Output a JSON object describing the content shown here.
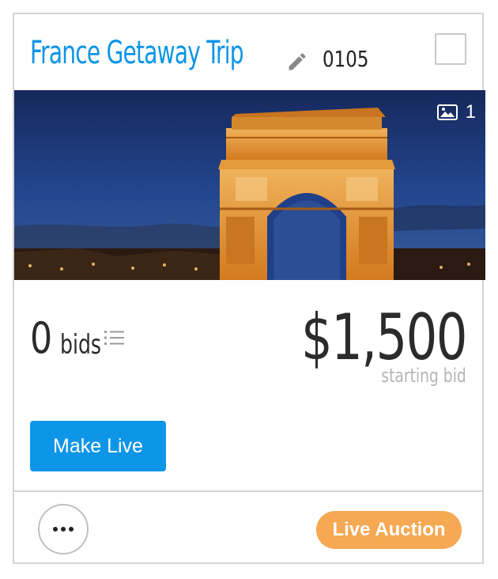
{
  "item": {
    "title": "France Getaway Trip",
    "number": "0105",
    "photo_count": "1",
    "photo_subject": "Arc de Triomphe at dusk"
  },
  "bids": {
    "count": "0",
    "label": "bids"
  },
  "price": {
    "amount": "$1,500",
    "caption": "starting bid"
  },
  "actions": {
    "make_live_label": "Make Live"
  },
  "footer": {
    "status_badge": "Live Auction"
  },
  "icons": {
    "edit": "pencil-icon",
    "photo": "image-icon",
    "bids_list": "list-icon",
    "more": "ellipsis-icon"
  },
  "colors": {
    "accent": "#0d95e8",
    "badge": "#f6a852",
    "text": "#2b2b2b",
    "muted": "#b5b5b5"
  }
}
